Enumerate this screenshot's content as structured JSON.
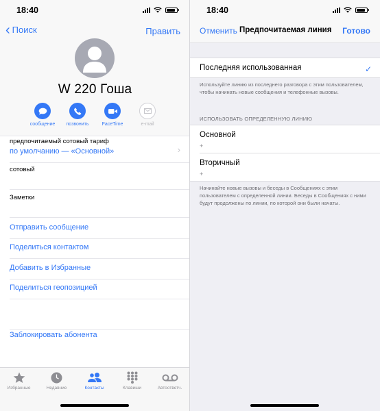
{
  "left": {
    "status": {
      "time": "18:40"
    },
    "nav": {
      "back_label": "Поиск",
      "edit_label": "Править"
    },
    "contact": {
      "name": "W  220 Гоша"
    },
    "actions": [
      {
        "label": "сообщение",
        "icon": "message-bubble-icon",
        "enabled": true
      },
      {
        "label": "позвонить",
        "icon": "phone-icon",
        "enabled": true
      },
      {
        "label": "FaceTime",
        "icon": "video-camera-icon",
        "enabled": true
      },
      {
        "label": "e-mail",
        "icon": "mail-icon",
        "enabled": false
      }
    ],
    "rows": {
      "tariff_label": "предпочитаемый сотовый тариф",
      "tariff_value": "по умолчанию — «Основной»",
      "cellular_label": "сотовый",
      "notes_label": "Заметки"
    },
    "links": [
      "Отправить сообщение",
      "Поделиться контактом",
      "Добавить в Избранные",
      "Поделиться геопозицией"
    ],
    "block_label": "Заблокировать абонента",
    "tabs": [
      {
        "label": "Избранные",
        "icon": "star-icon"
      },
      {
        "label": "Недавние",
        "icon": "clock-icon"
      },
      {
        "label": "Контакты",
        "icon": "contacts-icon",
        "active": true
      },
      {
        "label": "Клавиши",
        "icon": "keypad-icon"
      },
      {
        "label": "Автоответч.",
        "icon": "voicemail-icon"
      }
    ]
  },
  "right": {
    "status": {
      "time": "18:40"
    },
    "nav": {
      "cancel_label": "Отменить",
      "title": "Предпочитаемая линия",
      "done_label": "Готово"
    },
    "last_used": {
      "label": "Последняя использованная",
      "selected": true
    },
    "last_used_note": "Используйте линию из последнего разговора с этим пользователем, чтобы начинать новые сообщения и телефонные вызовы.",
    "section_header": "ИСПОЛЬЗОВАТЬ ОПРЕДЕЛЕННУЮ ЛИНИЮ",
    "lines": [
      {
        "label": "Основной",
        "sub": "+"
      },
      {
        "label": "Вторичный",
        "sub": "+"
      }
    ],
    "lines_note": "Начинайте новые вызовы и беседы в Сообщениях с этим пользователем с определенной линии. Беседы в Сообщениях с ними будут продолжены по линии, по которой они были начаты."
  },
  "colors": {
    "accent": "#3478f6",
    "grouped_bg": "#efeff4",
    "avatar": "#a7a9b3"
  }
}
